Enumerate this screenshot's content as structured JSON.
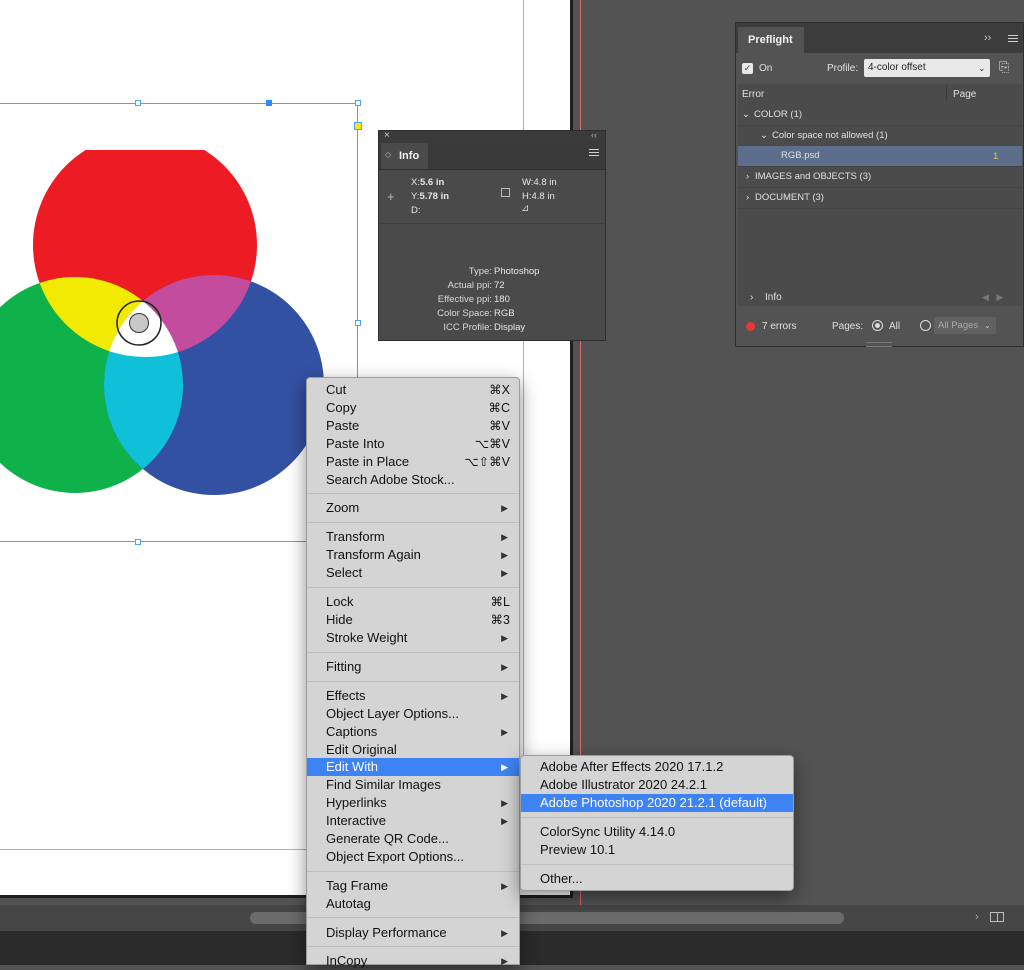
{
  "info_panel": {
    "close_glyph": "×",
    "collapse_glyph": "‹‹",
    "tab_label": "Info",
    "x_label": "X:",
    "x_value": "5.6 in",
    "y_label": "Y:",
    "y_value": "5.78 in",
    "d_label": "D:",
    "w_label": "W:",
    "w_value": "4.8 in",
    "h_label": "H:",
    "h_value": "4.8 in",
    "rows": [
      {
        "key": "Type:",
        "value": "Photoshop"
      },
      {
        "key": "Actual ppi:",
        "value": "72"
      },
      {
        "key": "Effective ppi:",
        "value": "180"
      },
      {
        "key": "Color Space:",
        "value": "RGB"
      },
      {
        "key": "ICC Profile:",
        "value": "Display"
      }
    ]
  },
  "preflight": {
    "tab_label": "Preflight",
    "collapse_glyph": "››",
    "on_label": "On",
    "profile_label": "Profile:",
    "profile_value": "4-color offset",
    "col_error": "Error",
    "col_page": "Page",
    "rows": [
      {
        "label": "COLOR (1)",
        "arrow": "⌄"
      },
      {
        "label": "Color space not allowed (1)",
        "arrow": "⌄"
      },
      {
        "label": "RGB.psd",
        "arrow": ""
      },
      {
        "label": "IMAGES and OBJECTS (3)",
        "arrow": "›"
      },
      {
        "label": "DOCUMENT (3)",
        "arrow": "›"
      }
    ],
    "rgb_page": "1",
    "info_label": "Info",
    "errors_label": "7 errors",
    "pages_label": "Pages:",
    "all_label": "All",
    "pages_field": "All Pages",
    "status_color": "#e63b3b"
  },
  "context_menu": {
    "items": [
      {
        "label": "Cut",
        "shortcut": "⌘X"
      },
      {
        "label": "Copy",
        "shortcut": "⌘C"
      },
      {
        "label": "Paste",
        "shortcut": "⌘V"
      },
      {
        "label": "Paste Into",
        "shortcut": "⌥⌘V"
      },
      {
        "label": "Paste in Place",
        "shortcut": "⌥⇧⌘V"
      },
      {
        "label": "Search Adobe Stock...",
        "shortcut": ""
      },
      {
        "label": "Zoom",
        "submenu": true
      },
      {
        "label": "Transform",
        "submenu": true
      },
      {
        "label": "Transform Again",
        "submenu": true
      },
      {
        "label": "Select",
        "submenu": true
      },
      {
        "label": "Lock",
        "shortcut": "⌘L"
      },
      {
        "label": "Hide",
        "shortcut": "⌘3"
      },
      {
        "label": "Stroke Weight",
        "submenu": true
      },
      {
        "label": "Fitting",
        "submenu": true
      },
      {
        "label": "Effects",
        "submenu": true
      },
      {
        "label": "Object Layer Options...",
        "shortcut": ""
      },
      {
        "label": "Captions",
        "submenu": true
      },
      {
        "label": "Edit Original",
        "shortcut": ""
      },
      {
        "label": "Edit With",
        "submenu": true,
        "active": true
      },
      {
        "label": "Find Similar Images",
        "shortcut": ""
      },
      {
        "label": "Hyperlinks",
        "submenu": true
      },
      {
        "label": "Interactive",
        "submenu": true
      },
      {
        "label": "Generate QR Code...",
        "shortcut": ""
      },
      {
        "label": "Object Export Options...",
        "shortcut": ""
      },
      {
        "label": "Tag Frame",
        "submenu": true
      },
      {
        "label": "Autotag",
        "shortcut": ""
      },
      {
        "label": "Display Performance",
        "submenu": true
      },
      {
        "label": "InCopy",
        "submenu": true
      }
    ],
    "submenu_arrow": "▶"
  },
  "edit_with_submenu": {
    "items": [
      {
        "label": "Adobe After Effects 2020 17.1.2"
      },
      {
        "label": "Adobe Illustrator 2020 24.2.1"
      },
      {
        "label": "Adobe Photoshop 2020 21.2.1 (default)",
        "active": true
      },
      {
        "label": "ColorSync Utility 4.14.0"
      },
      {
        "label": "Preview 10.1"
      },
      {
        "label": "Other..."
      }
    ]
  },
  "colors": {
    "menu_highlight": "#3e83f4",
    "circle_red": "#ed1c24",
    "circle_green": "#0fb14a",
    "circle_blue": "#3351a3",
    "overlap_yellow": "#f2ea00",
    "overlap_magenta": "#c34c9e",
    "overlap_cyan": "#10c0d8",
    "overlap_white": "#ffffff"
  }
}
